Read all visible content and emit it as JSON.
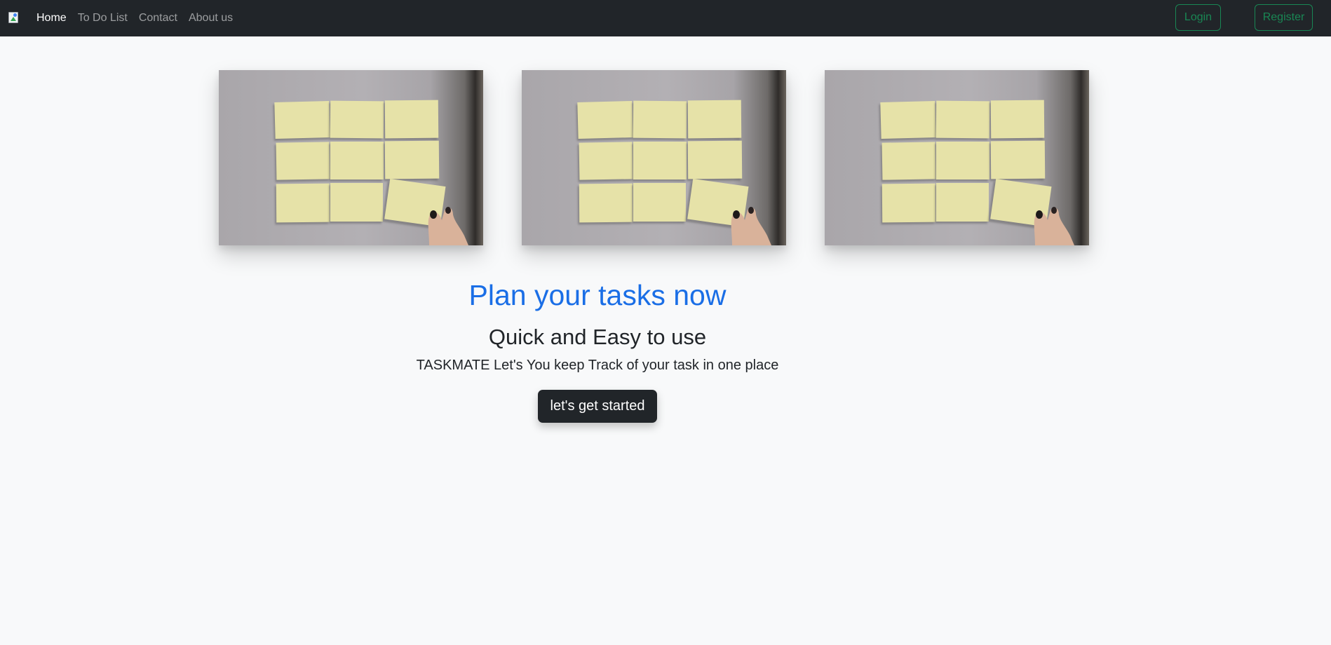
{
  "nav": {
    "brand_icon": "broken-image-icon",
    "links": [
      {
        "label": "Home",
        "active": true
      },
      {
        "label": "To Do List",
        "active": false
      },
      {
        "label": "Contact",
        "active": false
      },
      {
        "label": "About us",
        "active": false
      }
    ],
    "login_label": "Login",
    "register_label": "Register"
  },
  "gallery": {
    "image_subject": "sticky-notes-on-wall-photo",
    "count": 3
  },
  "hero": {
    "title": "Plan your tasks now",
    "subtitle": "Quick and Easy to use",
    "description": "TASKMATE Let's You keep Track of your task in one place",
    "cta_label": "let's get started"
  },
  "colors": {
    "navbar_bg": "#212529",
    "page_bg": "#f8f9fa",
    "title_blue": "#1a6ee6",
    "success_green": "#198754",
    "dark_button": "#212529",
    "sticky_note": "#e6e2a8"
  }
}
